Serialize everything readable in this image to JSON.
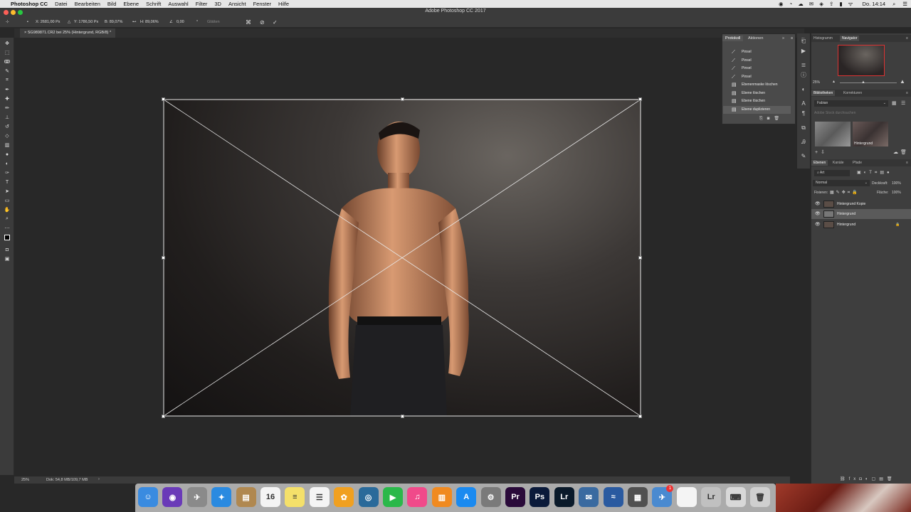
{
  "menubar": {
    "app_name": "Photoshop CC",
    "items": [
      "Datei",
      "Bearbeiten",
      "Bild",
      "Ebene",
      "Schrift",
      "Auswahl",
      "Filter",
      "3D",
      "Ansicht",
      "Fenster",
      "Hilfe"
    ],
    "clock": "Do. 14:14"
  },
  "window_title": "Adobe Photoshop CC 2017",
  "options": {
    "x": "X: 2681,00 Px",
    "y": "Y: 1786,50 Px",
    "w": "B: 89,07%",
    "h": "H: 89,06%",
    "angle": "0,00",
    "interp": "Glätten"
  },
  "doc_tab": "SG989871.CR2 bei 25% (Hintergrund, RGB/8) *",
  "status": {
    "zoom": "25%",
    "doc": "Dok: 54,8 MB/109,7 MB"
  },
  "protokoll": {
    "tabs": [
      "Protokoll",
      "Aktionen"
    ],
    "items": [
      "Pinsel",
      "Pinsel",
      "Pinsel",
      "Pinsel",
      "Ebenenmaske löschen",
      "Ebene löschen",
      "Ebene löschen",
      "Ebene duplizieren"
    ]
  },
  "navigator": {
    "tabs": [
      "Histogramm",
      "Navigator"
    ],
    "zoom": "25%"
  },
  "libraries": {
    "tabs": [
      "Bibliotheken",
      "Korrekturen"
    ],
    "dropdown": "Fabian",
    "search_placeholder": "Adobe Stock durchsuchen",
    "thumb_label": "Hintergrund"
  },
  "layers": {
    "tabs": [
      "Ebenen",
      "Kanäle",
      "Pfade"
    ],
    "filter": "Art",
    "blend": "Normal",
    "opacity_label": "Deckkraft:",
    "opacity": "100%",
    "fill_label": "Fläche:",
    "fill": "100%",
    "lock_label": "Fixieren:",
    "rows": [
      "Hintergrund Kopie",
      "Hintergrund",
      "Hintergrund"
    ]
  },
  "dock": {
    "apps": [
      {
        "icon": "finder-icon",
        "color": "#3a8be0",
        "glyph": "☺"
      },
      {
        "icon": "siri-icon",
        "color": "#6a3ab8",
        "glyph": "◉"
      },
      {
        "icon": "launchpad-icon",
        "color": "#8a8a8a",
        "glyph": "✈"
      },
      {
        "icon": "safari-icon",
        "color": "#2a8ae0",
        "glyph": "✦"
      },
      {
        "icon": "contacts-icon",
        "color": "#b08850",
        "glyph": "▤"
      },
      {
        "icon": "calendar-icon",
        "color": "#f4f4f4",
        "glyph": "16"
      },
      {
        "icon": "notes-icon",
        "color": "#f4e06a",
        "glyph": "≡"
      },
      {
        "icon": "reminders-icon",
        "color": "#f4f4f4",
        "glyph": "☰"
      },
      {
        "icon": "photos-icon",
        "color": "#f0a020",
        "glyph": "✿"
      },
      {
        "icon": "camera-icon",
        "color": "#2a6a9a",
        "glyph": "◎"
      },
      {
        "icon": "facetime-icon",
        "color": "#2ab84a",
        "glyph": "▶"
      },
      {
        "icon": "itunes-icon",
        "color": "#f04a8a",
        "glyph": "♫"
      },
      {
        "icon": "ibooks-icon",
        "color": "#f08a20",
        "glyph": "▥"
      },
      {
        "icon": "appstore-icon",
        "color": "#1a8af0",
        "glyph": "A"
      },
      {
        "icon": "system-preferences-icon",
        "color": "#7a7a7a",
        "glyph": "⚙"
      },
      {
        "icon": "premiere-icon",
        "color": "#2a0a3a",
        "glyph": "Pr"
      },
      {
        "icon": "photoshop-icon",
        "color": "#0a1a3a",
        "glyph": "Ps"
      },
      {
        "icon": "lightroom-icon",
        "color": "#0a1a2a",
        "glyph": "Lr"
      },
      {
        "icon": "bird-app-icon",
        "color": "#3a6aa0",
        "glyph": "✉"
      },
      {
        "icon": "stocks-icon",
        "color": "#2a5aa0",
        "glyph": "≈"
      },
      {
        "icon": "printer-icon",
        "color": "#505050",
        "glyph": "▦"
      },
      {
        "icon": "mail-icon",
        "color": "#4a8ad0",
        "glyph": "✈"
      },
      {
        "icon": "document-icon",
        "color": "#f4f4f4",
        "glyph": ""
      },
      {
        "icon": "lightroom-folder-icon",
        "color": "#c0c0c0",
        "glyph": "Lr"
      },
      {
        "icon": "keyboard-icon",
        "color": "#d8d8d8",
        "glyph": "⌨"
      },
      {
        "icon": "trash-icon",
        "color": "#cfcfcf",
        "glyph": "🗑"
      }
    ],
    "mail_badge": "1"
  }
}
